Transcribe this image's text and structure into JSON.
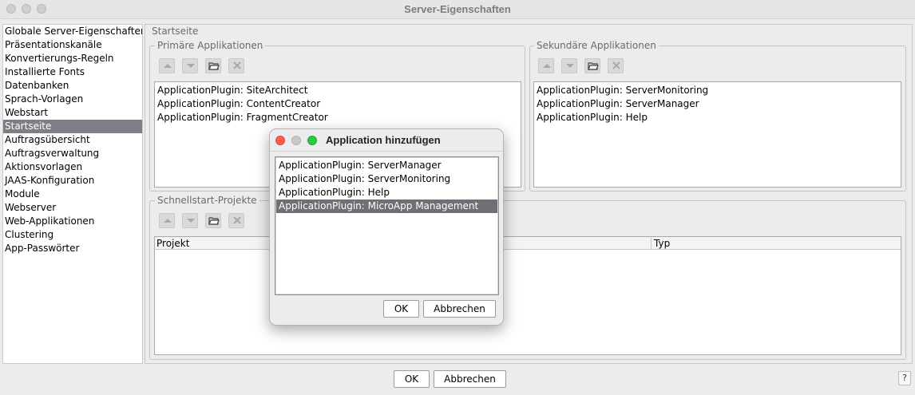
{
  "window": {
    "title": "Server-Eigenschaften"
  },
  "nav": {
    "items": [
      {
        "label": "Globale Server-Eigenschaften",
        "selected": false
      },
      {
        "label": "Präsentationskanäle",
        "selected": false
      },
      {
        "label": "Konvertierungs-Regeln",
        "selected": false
      },
      {
        "label": "Installierte Fonts",
        "selected": false
      },
      {
        "label": "Datenbanken",
        "selected": false
      },
      {
        "label": "Sprach-Vorlagen",
        "selected": false
      },
      {
        "label": "Webstart",
        "selected": false
      },
      {
        "label": "Startseite",
        "selected": true
      },
      {
        "label": "Auftragsübersicht",
        "selected": false
      },
      {
        "label": "Auftragsverwaltung",
        "selected": false
      },
      {
        "label": "Aktionsvorlagen",
        "selected": false
      },
      {
        "label": "JAAS-Konfiguration",
        "selected": false
      },
      {
        "label": "Module",
        "selected": false
      },
      {
        "label": "Webserver",
        "selected": false
      },
      {
        "label": "Web-Applikationen",
        "selected": false
      },
      {
        "label": "Clustering",
        "selected": false
      },
      {
        "label": "App-Passwörter",
        "selected": false
      }
    ]
  },
  "main": {
    "section_title": "Startseite",
    "primary": {
      "title": "Primäre Applikationen",
      "items": [
        "ApplicationPlugin: SiteArchitect",
        "ApplicationPlugin: ContentCreator",
        "ApplicationPlugin: FragmentCreator"
      ]
    },
    "secondary": {
      "title": "Sekundäre Applikationen",
      "items": [
        "ApplicationPlugin: ServerMonitoring",
        "ApplicationPlugin: ServerManager",
        "ApplicationPlugin: Help"
      ]
    },
    "quickstart": {
      "title": "Schnellstart-Projekte",
      "columns": [
        "Projekt",
        "Typ"
      ]
    }
  },
  "toolbar": {
    "icons": [
      "move-up-icon",
      "move-down-icon",
      "open-folder-icon",
      "remove-icon"
    ]
  },
  "footer": {
    "ok_label": "OK",
    "cancel_label": "Abbrechen",
    "help_label": "?"
  },
  "dialog": {
    "title": "Application hinzufügen",
    "items": [
      {
        "label": "ApplicationPlugin: ServerManager",
        "selected": false
      },
      {
        "label": "ApplicationPlugin: ServerMonitoring",
        "selected": false
      },
      {
        "label": "ApplicationPlugin: Help",
        "selected": false
      },
      {
        "label": "ApplicationPlugin: MicroApp Management",
        "selected": true
      }
    ],
    "ok_label": "OK",
    "cancel_label": "Abbrechen"
  },
  "colors": {
    "selection": "#7d7f84",
    "close": "#fc5f57",
    "minimize": "#c8c8c8",
    "zoom": "#2ac941"
  }
}
